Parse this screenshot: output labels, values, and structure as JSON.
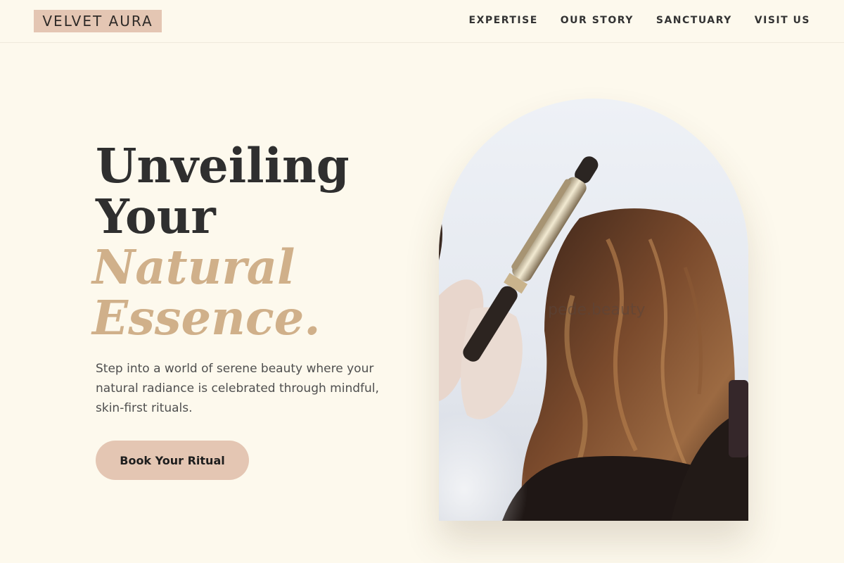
{
  "brand": {
    "name": "VELVET AURA"
  },
  "nav": {
    "items": [
      {
        "label": "EXPERTISE"
      },
      {
        "label": "OUR STORY"
      },
      {
        "label": "SANCTUARY"
      },
      {
        "label": "VISIT US"
      }
    ]
  },
  "hero": {
    "title_line1": "Unveiling",
    "title_line2": "Your",
    "title_accent1": "Natural",
    "title_accent2": "Essence.",
    "description": "Step into a world of serene beauty where your natural radiance is celebrated through mindful, skin-first rituals.",
    "cta_label": "Book Your Ritual",
    "image_watermark": "pede.beauty"
  },
  "colors": {
    "background": "#fdf9ed",
    "accent": "#d0b08a",
    "brand_block": "#e4c6b3",
    "text_dark": "#2f2f2f"
  }
}
